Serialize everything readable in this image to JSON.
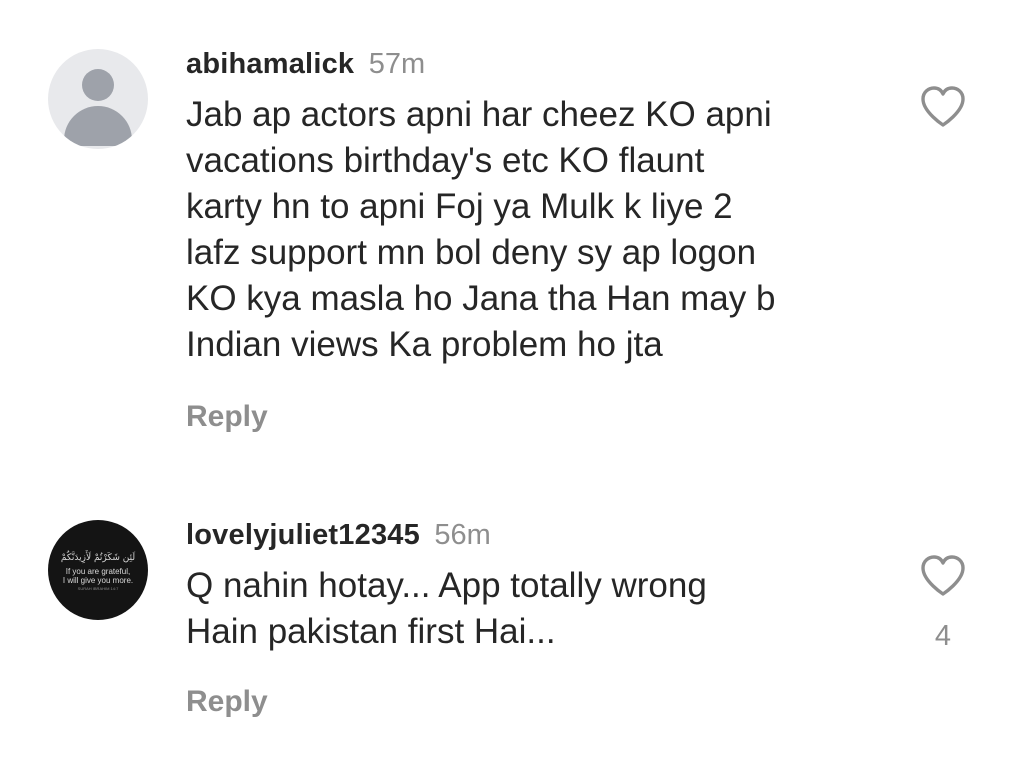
{
  "comments": [
    {
      "username": "abihamalick",
      "time": "57m",
      "text": "Jab ap actors apni har cheez KO apni\nvacations birthday's etc KO flaunt\nkarty hn to apni Foj ya Mulk k liye 2\nlafz support mn bol deny sy ap logon\nKO kya masla ho Jana tha Han may b\nIndian views Ka problem ho jta",
      "reply_label": "Reply",
      "like_icon": "heart-outline-icon",
      "avatar": "default-profile-avatar"
    },
    {
      "username": "lovelyjuliet12345",
      "time": "56m",
      "text": "Q nahin hotay... App totally wrong\nHain pakistan first Hai...",
      "reply_label": "Reply",
      "like_icon": "heart-outline-icon",
      "like_count": "4",
      "avatar": "quote-image-avatar",
      "avatar_text": {
        "arabic": "لَئِن شَكَرْتُمْ لَأَزِيدَنَّكُمْ",
        "line1": "If you are grateful,",
        "line2": "I will give you more.",
        "small": "SURAH IBRAHIM 14:7"
      }
    }
  ],
  "colors": {
    "background": "#ffffff",
    "primary_text": "#262626",
    "secondary_text": "#8e8e8e",
    "icon": "#8e8e8e"
  }
}
